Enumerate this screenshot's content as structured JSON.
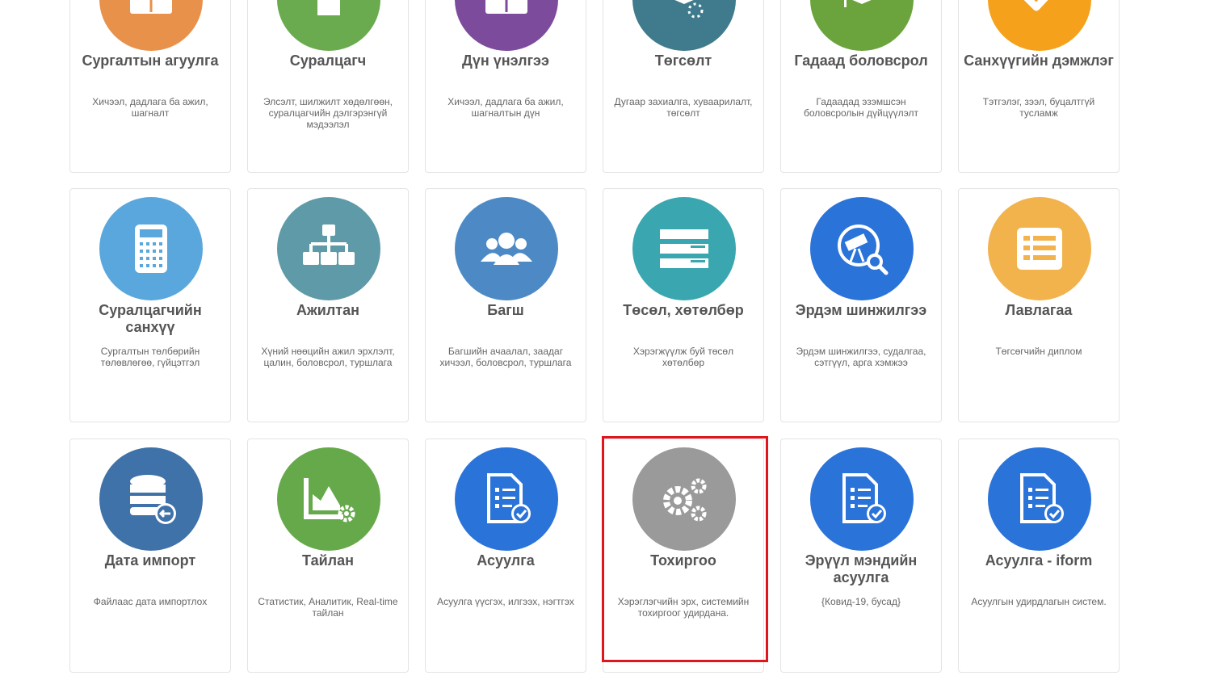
{
  "tiles": [
    {
      "title": "Сургалтын агуулга",
      "desc": "Хичээл, дадлага ба ажил, шагналт",
      "color": "#e8914a",
      "icon": "book-icon"
    },
    {
      "title": "Суралцагч",
      "desc": "Элсэлт, шилжилт хөдөлгөөн, суралцагчийн дэлгэрэнгүй мэдээлэл",
      "color": "#6aab4f",
      "icon": "student-icon"
    },
    {
      "title": "Дүн үнэлгээ",
      "desc": "Хичээл, дадлага ба ажил, шагналтын дүн",
      "color": "#7d4b9c",
      "icon": "grade-book-icon"
    },
    {
      "title": "Төгсөлт",
      "desc": "Дугаар захиалга, хуваарилалт, төгсөлт",
      "color": "#3f7b8c",
      "icon": "graduation-icon"
    },
    {
      "title": "Гадаад боловсрол",
      "desc": "Гадаадад эзэмшсэн боловсролын дүйцүүлэлт",
      "color": "#6ba33c",
      "icon": "globe-graduation-icon"
    },
    {
      "title": "Санхүүгийн дэмжлэг",
      "desc": "Тэтгэлэг, зээл, буцалтгүй тусламж",
      "color": "#f5a11c",
      "icon": "checkmark-icon"
    },
    {
      "title": "Суралцагчийн санхүү",
      "desc": "Сургалтын төлбөрийн төлөвлөгөө, гүйцэтгэл",
      "color": "#5aa7de",
      "icon": "calculator-icon"
    },
    {
      "title": "Ажилтан",
      "desc": "Хүний нөөцийн ажил эрхлэлт, цалин, боловсрол, туршлага",
      "color": "#5f9aa8",
      "icon": "org-chart-icon"
    },
    {
      "title": "Багш",
      "desc": "Багшийн ачаалал, заадаг хичээл, боловсрол, туршлага",
      "color": "#4d8ac5",
      "icon": "users-icon"
    },
    {
      "title": "Төсөл, хөтөлбөр",
      "desc": "Хэрэгжүүлж буй төсөл хөтөлбөр",
      "color": "#3aa7b0",
      "icon": "list-bars-icon"
    },
    {
      "title": "Эрдэм шинжилгээ",
      "desc": "Эрдэм шинжилгээ, судалгаа, сэтгүүл, арга хэмжээ",
      "color": "#2a73d9",
      "icon": "telescope-search-icon"
    },
    {
      "title": "Лавлагаа",
      "desc": "Төгсөгчийн диплом",
      "color": "#f2b34c",
      "icon": "document-list-icon"
    },
    {
      "title": "Дата импорт",
      "desc": "Файлаас дата импортлох",
      "color": "#3f72a8",
      "icon": "database-import-icon"
    },
    {
      "title": "Тайлан",
      "desc": "Статистик, Аналитик, Real-time тайлан",
      "color": "#66a94a",
      "icon": "chart-gear-icon"
    },
    {
      "title": "Асуулга",
      "desc": "Асуулга үүсгэх, илгээх, нэгтгэх",
      "color": "#2a73d9",
      "icon": "survey-check-icon"
    },
    {
      "title": "Тохиргоо",
      "desc": "Хэрэглэгчийн эрх, системийн тохиргоог удирдана.",
      "color": "#9a9a9a",
      "icon": "gears-icon"
    },
    {
      "title": "Эрүүл мэндийн асуулга",
      "desc": "{Ковид-19, бусад}",
      "color": "#2a73d9",
      "icon": "survey-check-icon"
    },
    {
      "title": "Асуулга - iform",
      "desc": "Асуулгын удирдлагын систем.",
      "color": "#2a73d9",
      "icon": "survey-check-icon"
    }
  ]
}
